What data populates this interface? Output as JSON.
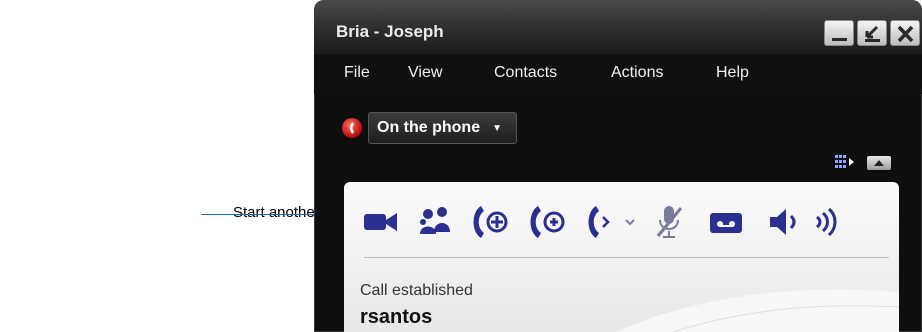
{
  "annotation": {
    "text": "Start another Call button"
  },
  "window": {
    "title": "Bria - Joseph",
    "controls": [
      "minimize-icon",
      "restore-icon",
      "close-icon"
    ]
  },
  "menu": {
    "items": [
      {
        "label": "File"
      },
      {
        "label": "View"
      },
      {
        "label": "Contacts"
      },
      {
        "label": "Actions"
      },
      {
        "label": "Help"
      }
    ]
  },
  "presence": {
    "status": "On the phone",
    "status_color": "#d21a12"
  },
  "toolbar": {
    "accent": "#2b2f8f",
    "buttons": [
      "video-icon",
      "contacts-icon",
      "conference-icon",
      "start-another-call-icon",
      "transfer-icon",
      "mute-mic-icon",
      "voicemail-icon",
      "speaker-icon",
      "volume-icon"
    ]
  },
  "call": {
    "status": "Call established",
    "contact": "rsantos"
  }
}
